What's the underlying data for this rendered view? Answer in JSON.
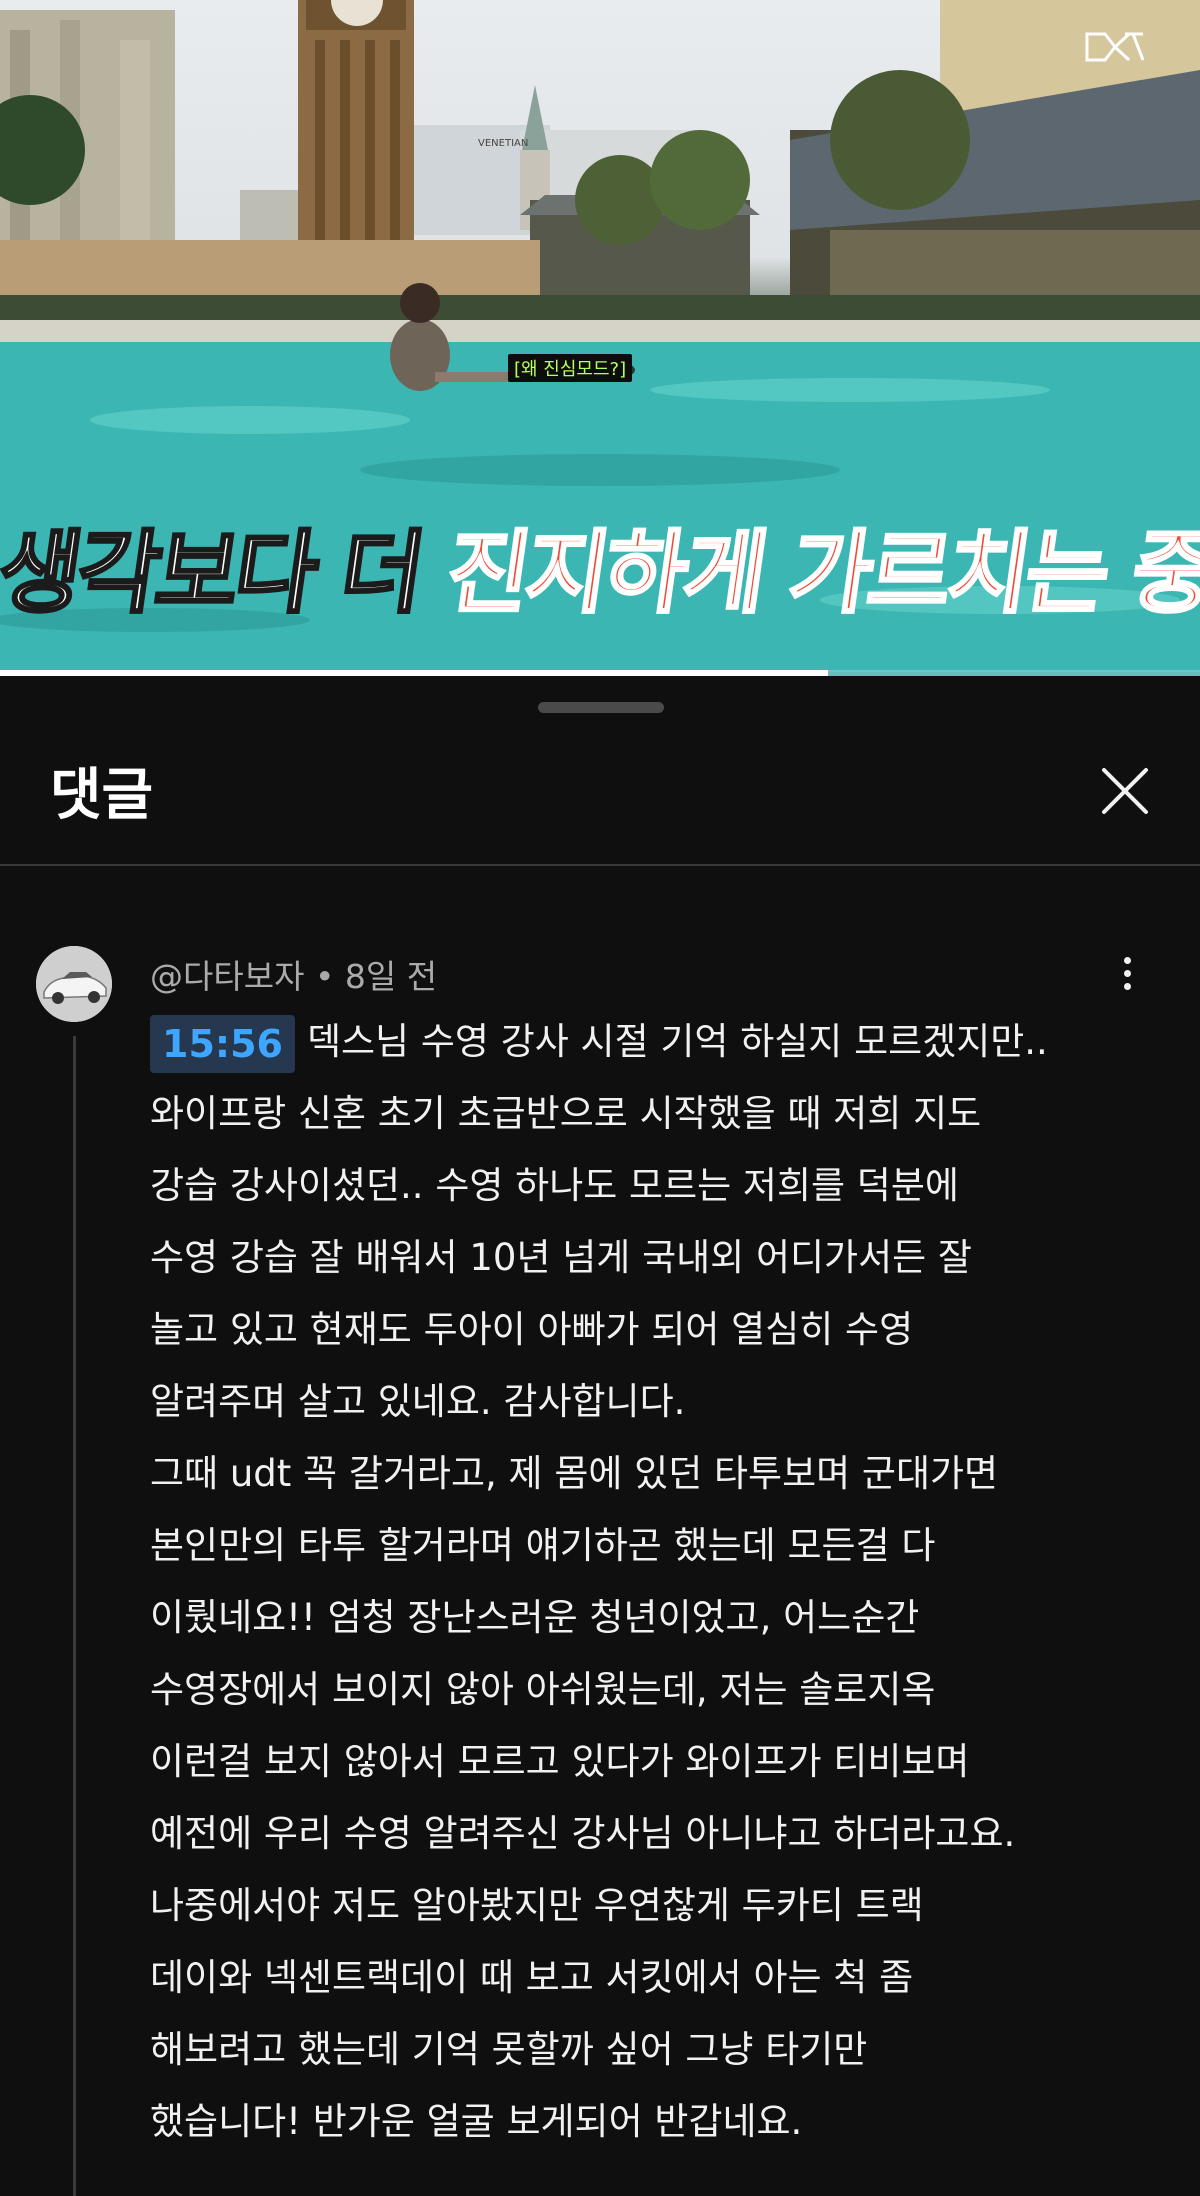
{
  "video": {
    "small_subtitle": "[왜 진심모드?]",
    "caption_white": "생각보다 더 ",
    "caption_red": "진지하게 가르치는 중",
    "progress_fraction": 0.69,
    "sign_text": "VENETIAN"
  },
  "comments": {
    "title": "댓글",
    "close_icon": "close-icon",
    "comment": {
      "author": "@다타보자",
      "separator": " • ",
      "age": "8일 전",
      "timestamp": "15:56",
      "lines": [
        "덱스님 수영 강사 시절 기억 하실지 모르겠지만..",
        "와이프랑 신혼 초기 초급반으로 시작했을 때 저희 지도",
        "강습 강사이셨던.. 수영 하나도 모르는 저희를 덕분에",
        "수영 강습 잘 배워서 10년 넘게 국내외 어디가서든 잘",
        "놀고 있고 현재도 두아이 아빠가 되어 열심히 수영",
        "알려주며 살고 있네요. 감사합니다.",
        "그때 udt 꼭 갈거라고, 제 몸에 있던 타투보며 군대가면",
        "본인만의 타투 할거라며 얘기하곤 했는데 모든걸 다",
        "이뤘네요!! 엄청 장난스러운 청년이었고, 어느순간",
        "수영장에서 보이지 않아 아쉬웠는데, 저는 솔로지옥",
        "이런걸 보지 않아서 모르고 있다가 와이프가 티비보며",
        "예전에 우리 수영 알려주신 강사님 아니냐고 하더라고요.",
        "나중에서야 저도 알아봤지만 우연찮게 두카티 트랙",
        "데이와 넥센트랙데이 때 보고 서킷에서 아는 척 좀",
        "해보려고 했는데 기억 못할까 싶어 그냥 타기만",
        "했습니다! 반가운 얼굴 보게되어 반갑네요."
      ]
    }
  },
  "colors": {
    "background": "#0f0f0f",
    "timestamp_bg": "#263850",
    "timestamp_text": "#3ea6ff",
    "caption_red": "#ef4a34"
  }
}
